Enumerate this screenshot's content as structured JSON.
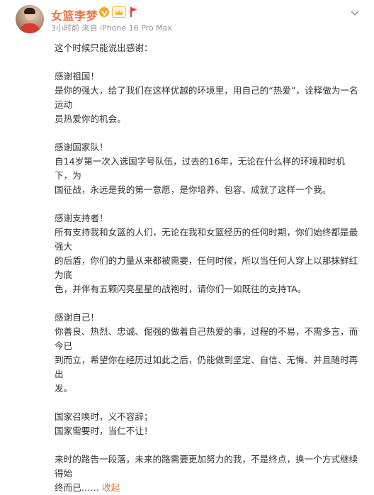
{
  "post": {
    "author": "女篮李梦",
    "time": "3小时前",
    "source": "来自 iPhone 16 Pro Max",
    "paragraphs": [
      [
        "这个时候只能说出感谢："
      ],
      [
        "感谢祖国！",
        "是你的强大，给了我们在这样优越的环境里，用自己的“热爱”，诠释做为一名运动",
        "员热爱你的机会。"
      ],
      [
        "感谢国家队！",
        "自14岁第一次入选国字号队伍，过去的16年，无论在什么样的环境和时机下，为",
        "国征战，永远是我的第一意愿，是你培养、包容、成就了这样一个我。"
      ],
      [
        "感谢支持者！",
        "所有支持我和女篮的人们，无论在我和女篮经历的任何时期，你们始终都是最强大",
        "的后盾，你们的力量从来都被需要，任何时候，所以当任何人穿上以那抹鲜红为底",
        "色，并伴有五颗闪亮星星的战袍时，请你们一如既往的支持TA。"
      ],
      [
        "感谢自己！",
        "你善良、热烈、忠诚、倔强的做着自己热爱的事，过程的不易，不需多言，而今已",
        "到而立，希望你在经历过如此之后，仍能做到坚定、自信、无悔、并且随时再出",
        "发。"
      ],
      [
        "国家召唤时，义不容辞；",
        "国家需要时，当仁不让！"
      ]
    ],
    "last_line_1": "来时的路告一段落，未来的路需要更加努力的我，不是终点，换一个方式继续得始",
    "last_line_2": "终而已……",
    "collapse_label": "收起"
  },
  "colors": {
    "accent": "#eb7340",
    "meta": "#939393",
    "text": "#333333"
  },
  "icons": {
    "verified": "verified-icon",
    "crown": "crown-icon",
    "flag": "flag-icon",
    "more": "chevron-down-icon"
  }
}
